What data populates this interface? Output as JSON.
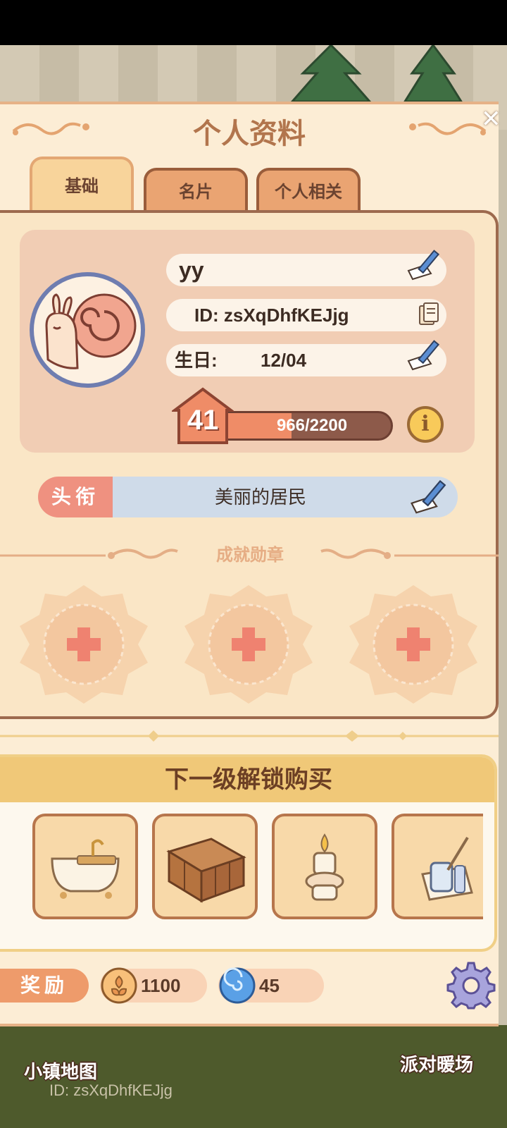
{
  "screen": {
    "title": "个人资料"
  },
  "tabs": [
    {
      "label": "基础",
      "active": true
    },
    {
      "label": "名片",
      "active": false
    },
    {
      "label": "个人相关",
      "active": false
    }
  ],
  "profile": {
    "name": "yy",
    "id_text": "ID: zsXqDhfKEJjg",
    "birthday_label": "生日:",
    "birthday_value": "12/04",
    "level": "41",
    "xp_text": "966/2200",
    "xp_fraction": 0.439,
    "title_label": "头衔",
    "title_value": "美丽的居民"
  },
  "achievements": {
    "section_label": "成就勋章",
    "slots": [
      "empty",
      "empty",
      "empty"
    ]
  },
  "unlock": {
    "heading": "下一级解锁购买",
    "items": [
      "bathtub-icon",
      "cabinet-icon",
      "candle-icon",
      "cup-brush-icon"
    ]
  },
  "rewards": {
    "label": "奖励",
    "coins": "1100",
    "gems": "45"
  },
  "background": {
    "map_label": "小镇地图",
    "party_label": "派对暖场",
    "id_text": "ID:  zsXqDhfKEJjg"
  },
  "colors": {
    "panel": "#fcedd5",
    "accent": "#ef9180",
    "title_brown": "#b2754d",
    "xp_fill": "#ef8c67",
    "title_blue": "#cfdbe9"
  }
}
